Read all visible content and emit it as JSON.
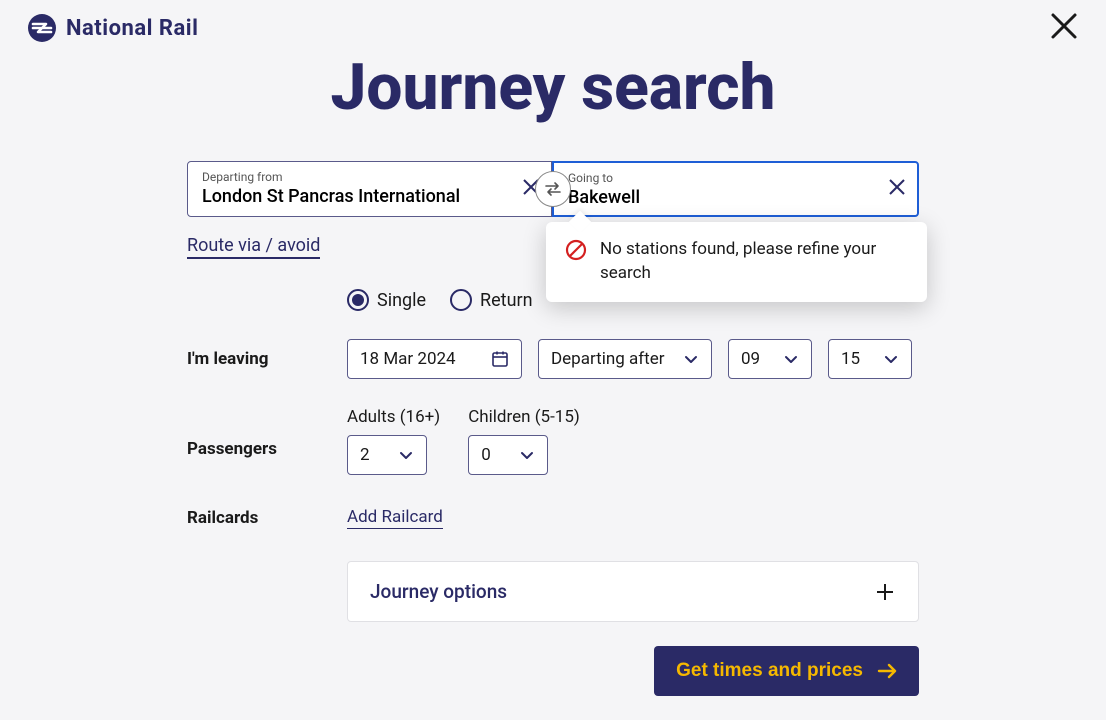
{
  "brand": "National Rail",
  "page_title": "Journey search",
  "from": {
    "label": "Departing from",
    "value": "London St Pancras International"
  },
  "to": {
    "label": "Going to",
    "value": "Bakewell"
  },
  "dropdown_msg": "No stations found, please refine your search",
  "route_link": "Route via / avoid",
  "trip_type": {
    "single": "Single",
    "return": "Return",
    "selected": "single"
  },
  "leaving": {
    "label": "I'm leaving",
    "date": "18 Mar 2024",
    "mode": "Departing after",
    "hour": "09",
    "minute": "15"
  },
  "passengers": {
    "label": "Passengers",
    "adults_label": "Adults (16+)",
    "children_label": "Children (5-15)",
    "adults": "2",
    "children": "0"
  },
  "railcards": {
    "label": "Railcards",
    "add": "Add Railcard"
  },
  "journey_options": "Journey options",
  "cta": "Get times and prices"
}
